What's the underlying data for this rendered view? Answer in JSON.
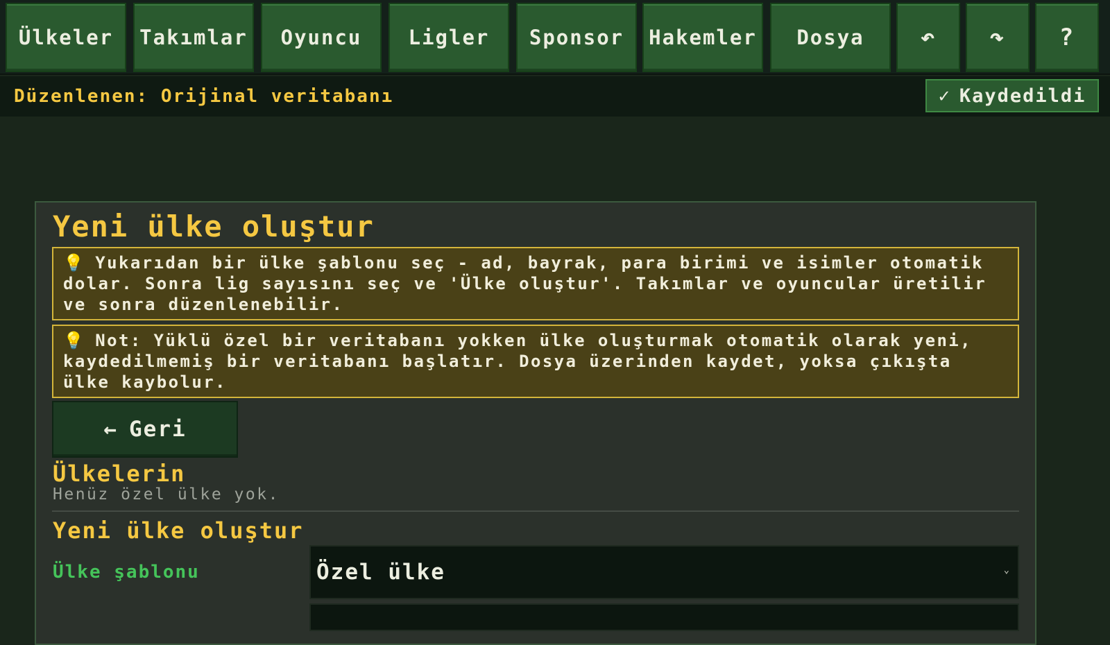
{
  "toolbar": {
    "items": [
      {
        "label": "Ülkeler"
      },
      {
        "label": "Takımlar"
      },
      {
        "label": "Oyuncu"
      },
      {
        "label": "Ligler"
      },
      {
        "label": "Sponsor"
      },
      {
        "label": "Hakemler"
      },
      {
        "label": "Dosya"
      },
      {
        "label": "↶",
        "icon": "undo-icon"
      },
      {
        "label": "↷",
        "icon": "redo-icon"
      },
      {
        "label": "?",
        "icon": "help-icon"
      }
    ]
  },
  "status": {
    "editing": "Düzenlenen: Orijinal veritabanı",
    "saved_check": "✓",
    "saved_label": "Kaydedildi"
  },
  "panel": {
    "title": "Yeni ülke oluştur",
    "notices": [
      {
        "icon": "lightbulb-icon",
        "glyph": "💡",
        "text": "Yukarıdan bir ülke şablonu seç - ad, bayrak, para birimi ve isimler otomatik dolar. Sonra lig sayısını seç ve 'Ülke oluştur'. Takımlar ve oyuncular üretilir ve sonra düzenlenebilir."
      },
      {
        "icon": "lightbulb-icon",
        "glyph": "💡",
        "text": "Not: Yüklü özel bir veritabanı yokken ülke oluşturmak otomatik olarak yeni, kaydedilmemiş bir veritabanı başlatır. Dosya üzerinden kaydet, yoksa çıkışta ülke kaybolur."
      }
    ],
    "back_arrow": "←",
    "back_label": "Geri",
    "countries_title": "Ülkelerin",
    "countries_empty": "Henüz özel ülke yok.",
    "create_title": "Yeni ülke oluştur",
    "template_label": "Ülke şablonu",
    "template_value": "Özel ülke"
  },
  "colors": {
    "accent": "#f5c842",
    "button_green": "#2a5a2f",
    "label_green": "#45c45a",
    "notice_bg": "#4a4117",
    "notice_border": "#d4b53a"
  }
}
